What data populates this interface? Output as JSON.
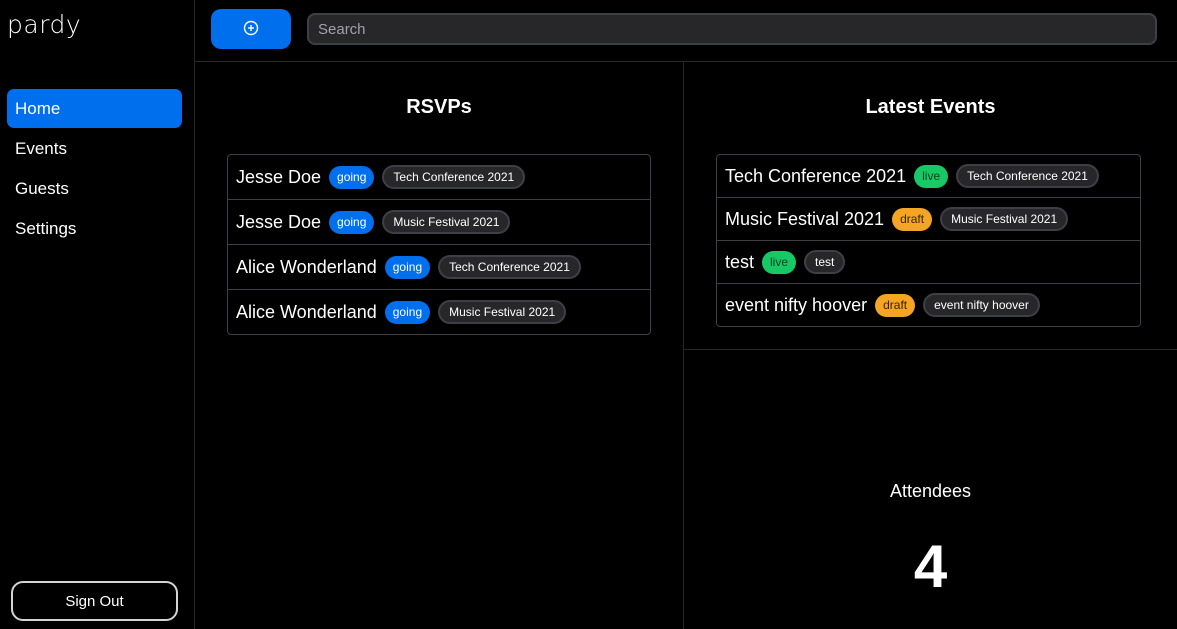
{
  "app": {
    "logo": "pardy"
  },
  "sidebar": {
    "items": [
      {
        "label": "Home"
      },
      {
        "label": "Events"
      },
      {
        "label": "Guests"
      },
      {
        "label": "Settings"
      }
    ],
    "sign_out_label": "Sign Out"
  },
  "topbar": {
    "add_icon": "plus-circle-icon",
    "search_placeholder": "Search"
  },
  "rsvps": {
    "title": "RSVPs",
    "rows": [
      {
        "name": "Jesse Doe",
        "status": "going",
        "event": "Tech Conference 2021"
      },
      {
        "name": "Jesse Doe",
        "status": "going",
        "event": "Music Festival 2021"
      },
      {
        "name": "Alice Wonderland",
        "status": "going",
        "event": "Tech Conference 2021"
      },
      {
        "name": "Alice Wonderland",
        "status": "going",
        "event": "Music Festival 2021"
      }
    ]
  },
  "latest_events": {
    "title": "Latest Events",
    "rows": [
      {
        "name": "Tech Conference 2021",
        "status": "live",
        "tag": "Tech Conference 2021"
      },
      {
        "name": "Music Festival 2021",
        "status": "draft",
        "tag": "Music Festival 2021"
      },
      {
        "name": "test",
        "status": "live",
        "tag": "test"
      },
      {
        "name": "event nifty hoover",
        "status": "draft",
        "tag": "event nifty hoover"
      }
    ]
  },
  "attendees": {
    "label": "Attendees",
    "count": "4"
  },
  "colors": {
    "accent": "#006fee",
    "live": "#17c964",
    "draft": "#f5a524",
    "background": "#000000"
  }
}
